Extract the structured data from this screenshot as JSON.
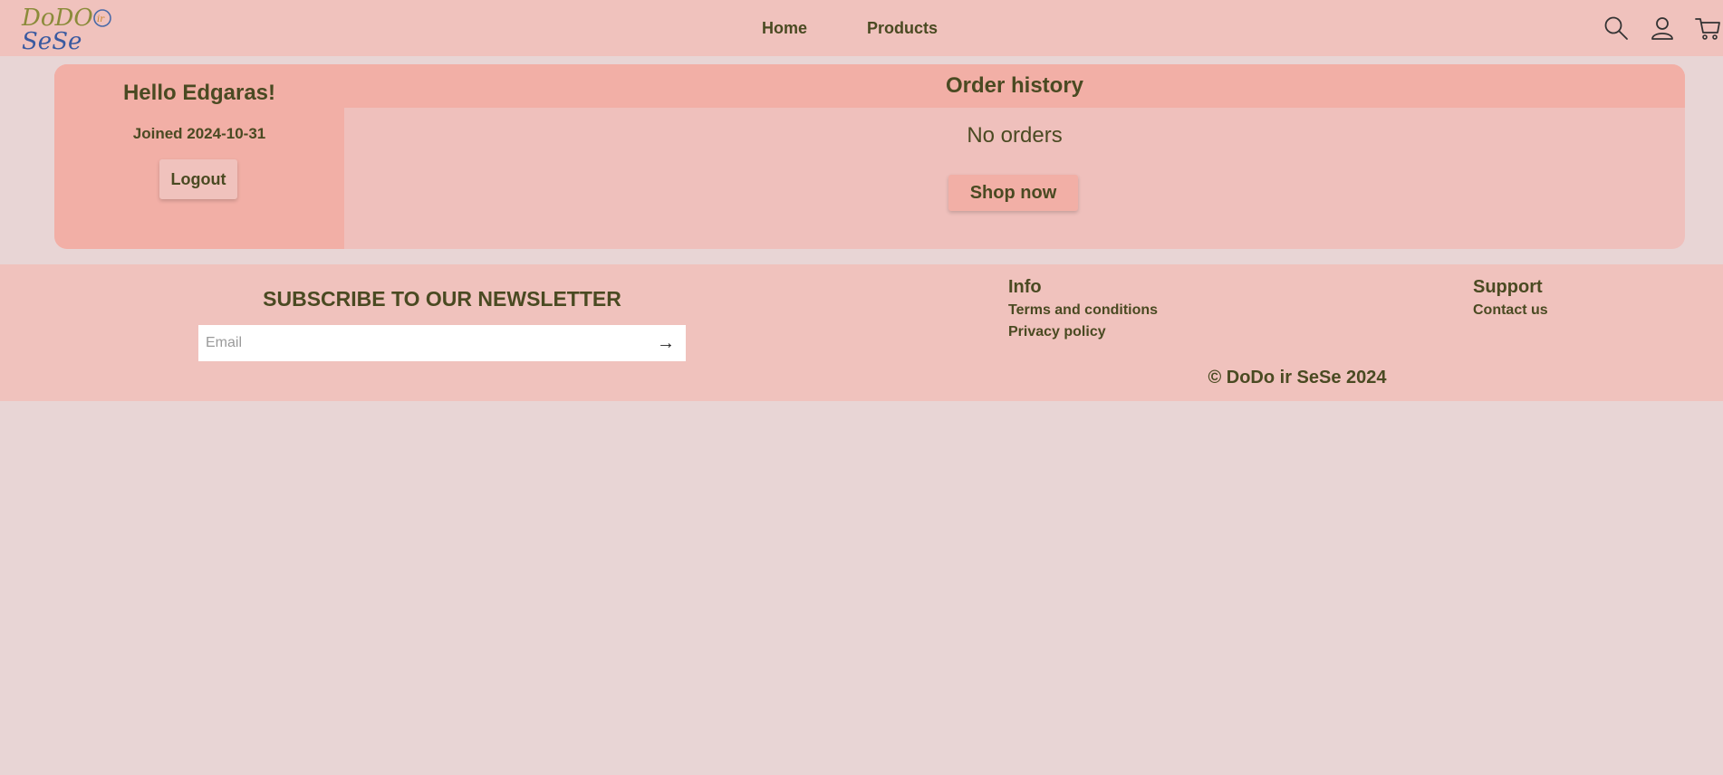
{
  "header": {
    "logo": {
      "line1": "DoDO",
      "badge": "ir",
      "line2": "SeSe"
    },
    "nav": [
      {
        "label": "Home"
      },
      {
        "label": "Products"
      }
    ],
    "icons": [
      "search-icon",
      "user-icon",
      "cart-icon"
    ]
  },
  "profile": {
    "greeting": "Hello Edgaras!",
    "joined": "Joined 2024-10-31",
    "logout_label": "Logout"
  },
  "orders": {
    "title": "Order history",
    "empty_text": "No orders",
    "shop_label": "Shop now"
  },
  "footer": {
    "newsletter_title": "SUBSCRIBE TO OUR NEWSLETTER",
    "email_placeholder": "Email",
    "email_value": "",
    "submit_arrow": "→",
    "info": {
      "title": "Info",
      "links": [
        "Terms and conditions",
        "Privacy policy"
      ]
    },
    "support": {
      "title": "Support",
      "links": [
        "Contact us"
      ]
    },
    "copyright": "© DoDo ir SeSe 2024"
  },
  "colors": {
    "header_bg": "#f0c2bd",
    "page_bg": "#e8d5d5",
    "accent": "#f2afa6",
    "text": "#4a4a22"
  }
}
